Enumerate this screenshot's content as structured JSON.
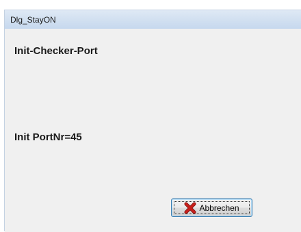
{
  "window": {
    "title": "Dlg_StayON"
  },
  "dialog": {
    "heading": "Init-Checker-Port",
    "status": "Init PortNr=45"
  },
  "buttons": {
    "cancel_label": "Abbrechen",
    "cancel_icon": "red-x-icon"
  },
  "colors": {
    "titlebar": "#d3e1f1",
    "client_background": "#f0f0f0",
    "icon_red": "#c8201c"
  }
}
